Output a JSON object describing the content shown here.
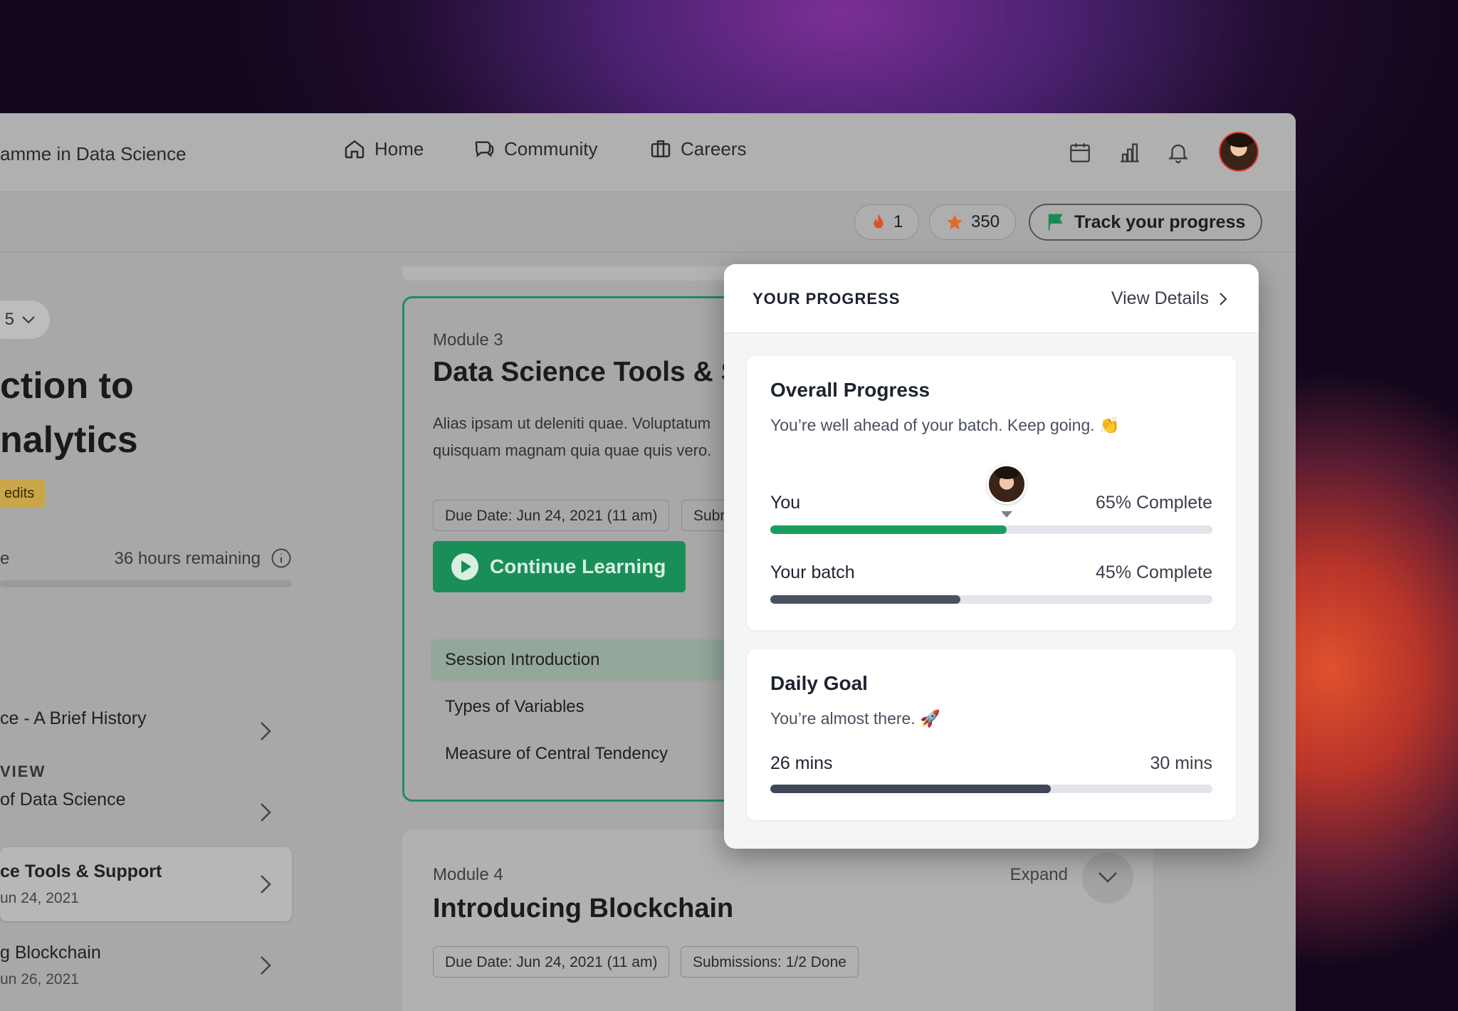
{
  "header": {
    "program_title": "amme in Data Science",
    "nav": [
      {
        "label": "Home",
        "icon": "home-icon"
      },
      {
        "label": "Community",
        "icon": "chat-icon"
      },
      {
        "label": "Careers",
        "icon": "briefcase-icon"
      }
    ],
    "icons": [
      "calendar-icon",
      "bar-chart-icon",
      "bell-icon"
    ]
  },
  "subbar": {
    "streak_count": "1",
    "points": "350",
    "track_label": "Track your progress"
  },
  "sidebar": {
    "semester_value": "5",
    "course_title_line1": "ction to",
    "course_title_line2": "nalytics",
    "credits_label": "edits",
    "progress_left": "e",
    "hours_remaining": "36 hours remaining",
    "overview_label": "VIEW",
    "modules": [
      {
        "title": "ce - A Brief History",
        "date": ""
      },
      {
        "title": "of Data Science",
        "date": ""
      },
      {
        "title": "ce Tools & Support",
        "date": "un 24, 2021"
      },
      {
        "title": "g Blockchain",
        "date": "un 26, 2021"
      }
    ]
  },
  "module3": {
    "label": "Module 3",
    "title": "Data Science Tools & Su",
    "description": "Alias ipsam ut deleniti quae. Voluptatum quisquam magnam quia quae quis vero.",
    "due_tag": "Due Date: Jun 24, 2021 (11 am)",
    "sub_tag": "Subr",
    "continue_label": "Continue Learning",
    "sessions": [
      "Session Introduction",
      "Types of Variables",
      "Measure of Central Tendency"
    ]
  },
  "module4": {
    "label": "Module 4",
    "title": "Introducing Blockchain",
    "expand_label": "Expand",
    "due_tag": "Due Date: Jun 24, 2021 (11 am)",
    "sub_tag": "Submissions: 1/2 Done"
  },
  "progress_popover": {
    "heading": "YOUR PROGRESS",
    "view_details": "View Details",
    "overall": {
      "title": "Overall Progress",
      "subtitle": "You’re well ahead of your batch. Keep going. 👏",
      "you_label": "You",
      "you_value": "65% Complete",
      "you_fraction": 0.535,
      "batch_label": "Your batch",
      "batch_value": "45% Complete",
      "batch_fraction": 0.43
    },
    "daily": {
      "title": "Daily Goal",
      "subtitle": "You’re almost there.  🚀",
      "current": "26 mins",
      "target": "30 mins",
      "fraction": 0.635
    }
  },
  "colors": {
    "accent_green": "#1a9e5f",
    "batch_bar": "#4a5262",
    "daily_bar": "#3f4756"
  }
}
